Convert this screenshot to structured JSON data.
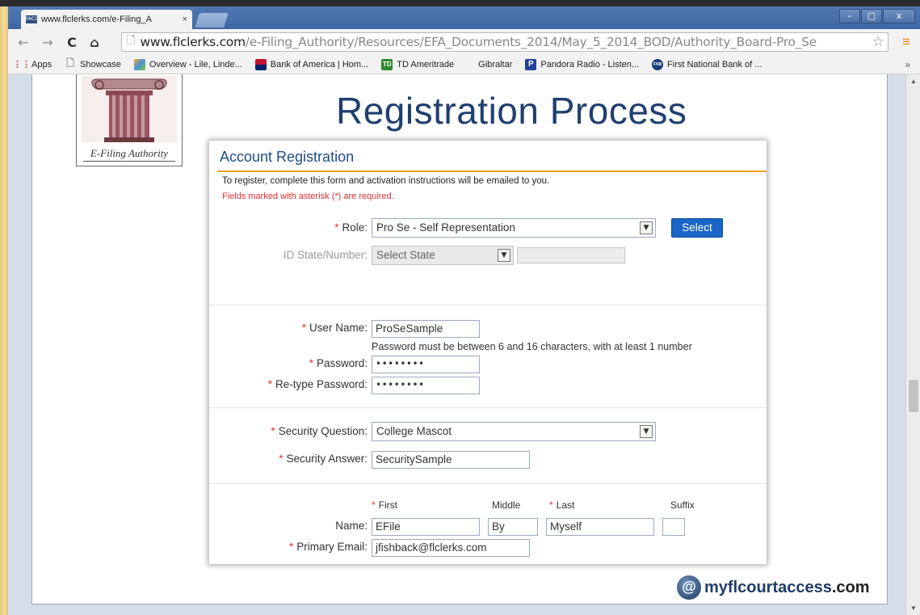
{
  "browser": {
    "tab_title": "www.flclerks.com/e-Filing_A",
    "favicon_text": "FACC",
    "tab_close": "×",
    "url_host": "www.flclerks.com",
    "url_path": "/e-Filing_Authority/Resources/EFA_Documents_2014/May_5_2014_BOD/Authority_Board-Pro_Se",
    "window_controls": {
      "minimize": "–",
      "maximize": "▢",
      "close": "x"
    },
    "nav": {
      "back": "←",
      "forward": "→",
      "reload": "C",
      "home": "⌂"
    },
    "bookmarks": [
      {
        "label": "Apps",
        "icon": "apps-grid-icon"
      },
      {
        "label": "Showcase",
        "icon": "page-icon"
      },
      {
        "label": "Overview - Lile, Linde...",
        "icon": "colorful-logo-icon"
      },
      {
        "label": "Bank of America | Hom...",
        "icon": "bofa-flag-icon"
      },
      {
        "label": "TD Ameritrade",
        "icon": "td-icon"
      },
      {
        "label": "Gibraltar",
        "icon": "none"
      },
      {
        "label": "Pandora Radio - Listen...",
        "icon": "pandora-icon"
      },
      {
        "label": "First National Bank of ...",
        "icon": "fnb-icon"
      }
    ],
    "bookmarks_more": "»",
    "bookmark_badges": {
      "td": "TD",
      "pandora": "P",
      "fnb": "FNB"
    }
  },
  "slide": {
    "title": "Registration Process",
    "logo_caption": "E-Filing Authority"
  },
  "form": {
    "heading": "Account Registration",
    "intro": "To register, complete this form and activation instructions will be emailed to you.",
    "required_note": "Fields marked with asterisk (*) are required.",
    "asterisk": "*",
    "role_label": "Role:",
    "role_value": "Pro Se - Self Representation",
    "select_button": "Select",
    "id_label": "ID State/Number:",
    "id_state_value": "Select State",
    "username_label": "User Name:",
    "username_value": "ProSeSample",
    "password_hint": "Password must be between 6 and 16 characters, with at least 1 number",
    "password_label": "Password:",
    "password_value": "••••••••",
    "retype_label": "Re-type Password:",
    "retype_value": "••••••••",
    "security_q_label": "Security Question:",
    "security_q_value": "College Mascot",
    "security_a_label": "Security Answer:",
    "security_a_value": "SecuritySample",
    "col_first": "First",
    "col_middle": "Middle",
    "col_last": "Last",
    "col_suffix": "Suffix",
    "name_label": "Name:",
    "first_value": "EFile",
    "middle_value": "By",
    "last_value": "Myself",
    "suffix_value": "",
    "email_label": "Primary Email:",
    "email_value": "jfishback@flclerks.com"
  },
  "footer": {
    "brand_symbol": "@",
    "brand_name": "myflcourtaccess",
    "brand_tld": ".com"
  }
}
